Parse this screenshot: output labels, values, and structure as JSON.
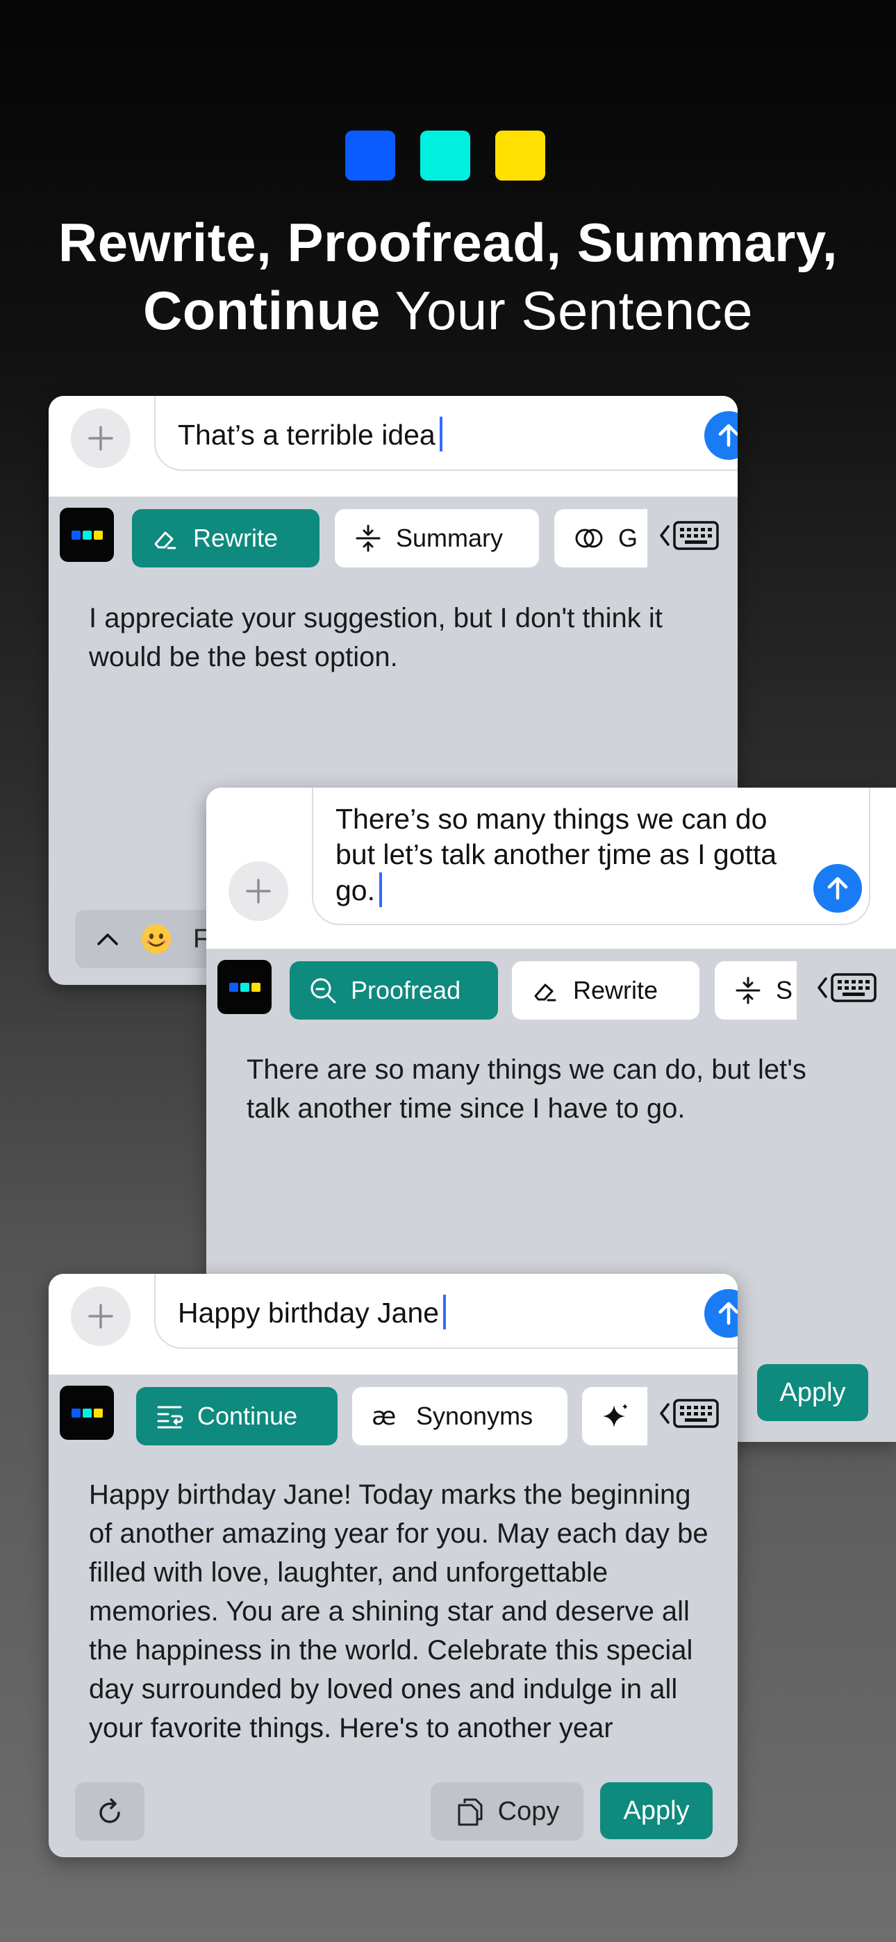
{
  "brand_colors": [
    "#0a5cff",
    "#00f0e0",
    "#ffe000"
  ],
  "headline": {
    "line1": "Rewrite, Proofread, Summary,",
    "line2_bold": "Continue",
    "line2_light": "Your Sentence"
  },
  "card1": {
    "input_text": "That’s a terrible idea",
    "chips": [
      "Rewrite",
      "Summary",
      "G"
    ],
    "result": "I appreciate your suggestion, but I don't think it would be the best option.",
    "bottom_chip": "Fr"
  },
  "card2": {
    "input_text": "There’s so many things we can do but let’s talk another tjme as I gotta go.",
    "chips": [
      "Proofread",
      "Rewrite",
      "S"
    ],
    "result": "There are so many things we can do, but let's talk another time since I have to go.",
    "apply_label": "Apply"
  },
  "card3": {
    "input_text": "Happy birthday Jane",
    "chips": [
      "Continue",
      "Synonyms"
    ],
    "result": "Happy birthday Jane! Today marks the beginning of another amazing year for you. May each day be filled with love, laughter, and unforgettable memories. You are a shining star and deserve all the happiness in the world. Celebrate this special day surrounded by loved ones and indulge in all your favorite things. Here's to another year",
    "copy_label": "Copy",
    "apply_label": "Apply"
  },
  "accent_color": "#0e8a7e",
  "send_color": "#1a7cf5"
}
